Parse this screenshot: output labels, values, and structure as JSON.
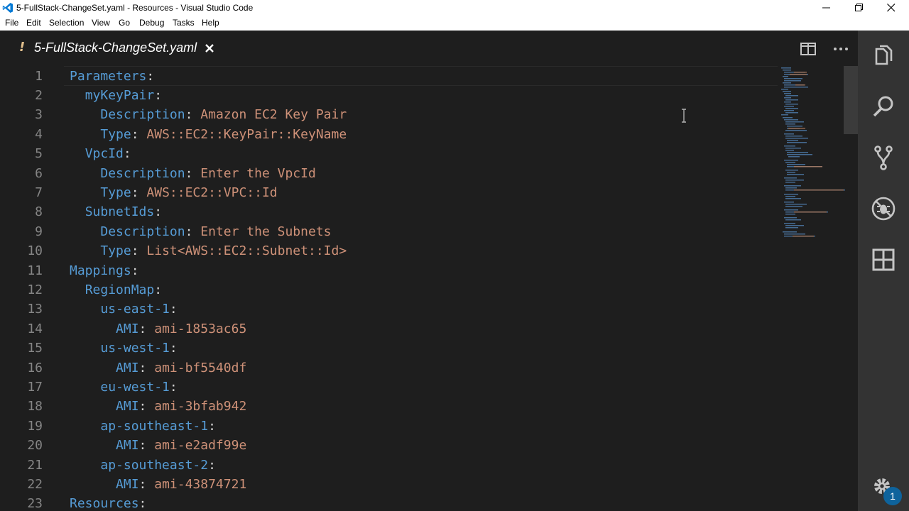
{
  "window": {
    "title": "5-FullStack-ChangeSet.yaml - Resources - Visual Studio Code"
  },
  "menu": [
    "File",
    "Edit",
    "Selection",
    "View",
    "Go",
    "Debug",
    "Tasks",
    "Help"
  ],
  "tab": {
    "modified_marker": "!",
    "title": "5-FullStack-ChangeSet.yaml"
  },
  "colors": {
    "key": "#569cd6",
    "value": "#ce9178",
    "line_number": "#858585",
    "background": "#1e1e1e",
    "activity_bar": "#333333",
    "badge": "#0e639c"
  },
  "editor": {
    "lines": [
      {
        "n": "1",
        "indent": "",
        "key": "Parameters",
        "value": ""
      },
      {
        "n": "2",
        "indent": "  ",
        "key": "myKeyPair",
        "value": ""
      },
      {
        "n": "3",
        "indent": "    ",
        "key": "Description",
        "value": "Amazon EC2 Key Pair"
      },
      {
        "n": "4",
        "indent": "    ",
        "key": "Type",
        "value": "AWS::EC2::KeyPair::KeyName"
      },
      {
        "n": "5",
        "indent": "  ",
        "key": "VpcId",
        "value": ""
      },
      {
        "n": "6",
        "indent": "    ",
        "key": "Description",
        "value": "Enter the VpcId"
      },
      {
        "n": "7",
        "indent": "    ",
        "key": "Type",
        "value": "AWS::EC2::VPC::Id"
      },
      {
        "n": "8",
        "indent": "  ",
        "key": "SubnetIds",
        "value": ""
      },
      {
        "n": "9",
        "indent": "    ",
        "key": "Description",
        "value": "Enter the Subnets"
      },
      {
        "n": "10",
        "indent": "    ",
        "key": "Type",
        "value": "List<AWS::EC2::Subnet::Id>"
      },
      {
        "n": "11",
        "indent": "",
        "key": "Mappings",
        "value": ""
      },
      {
        "n": "12",
        "indent": "  ",
        "key": "RegionMap",
        "value": ""
      },
      {
        "n": "13",
        "indent": "    ",
        "key": "us-east-1",
        "value": ""
      },
      {
        "n": "14",
        "indent": "      ",
        "key": "AMI",
        "value": "ami-1853ac65"
      },
      {
        "n": "15",
        "indent": "    ",
        "key": "us-west-1",
        "value": ""
      },
      {
        "n": "16",
        "indent": "      ",
        "key": "AMI",
        "value": "ami-bf5540df"
      },
      {
        "n": "17",
        "indent": "    ",
        "key": "eu-west-1",
        "value": ""
      },
      {
        "n": "18",
        "indent": "      ",
        "key": "AMI",
        "value": "ami-3bfab942"
      },
      {
        "n": "19",
        "indent": "    ",
        "key": "ap-southeast-1",
        "value": ""
      },
      {
        "n": "20",
        "indent": "      ",
        "key": "AMI",
        "value": "ami-e2adf99e"
      },
      {
        "n": "21",
        "indent": "    ",
        "key": "ap-southeast-2",
        "value": ""
      },
      {
        "n": "22",
        "indent": "      ",
        "key": "AMI",
        "value": "ami-43874721"
      },
      {
        "n": "23",
        "indent": "",
        "key": "Resources",
        "value": ""
      }
    ]
  },
  "activity_bar": {
    "items": [
      "explorer-icon",
      "search-icon",
      "source-control-icon",
      "debug-icon",
      "extensions-icon"
    ],
    "settings_badge": "1"
  }
}
